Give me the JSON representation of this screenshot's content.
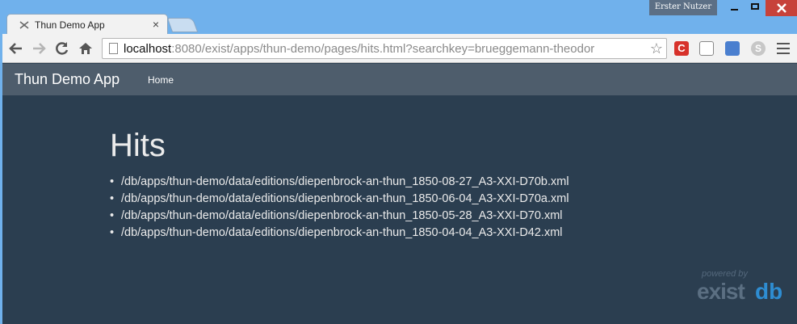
{
  "browser": {
    "tab_title": "Thun Demo App",
    "tab_close": "×",
    "profile_name": "Erster Nutzer",
    "url_host": "localhost",
    "url_rest": ":8080/exist/apps/thun-demo/pages/hits.html?searchkey=brueggemann-theodor",
    "star": "☆",
    "ext_c_label": "C",
    "ext_skype_label": "S"
  },
  "navbar": {
    "brand": "Thun Demo App",
    "home": "Home"
  },
  "main": {
    "heading": "Hits",
    "hits": [
      "/db/apps/thun-demo/data/editions/diepenbrock-an-thun_1850-08-27_A3-XXI-D70b.xml",
      "/db/apps/thun-demo/data/editions/diepenbrock-an-thun_1850-06-04_A3-XXI-D70a.xml",
      "/db/apps/thun-demo/data/editions/diepenbrock-an-thun_1850-05-28_A3-XXI-D70.xml",
      "/db/apps/thun-demo/data/editions/diepenbrock-an-thun_1850-04-04_A3-XXI-D42.xml"
    ]
  },
  "footer_logo": {
    "powered_by": "powered by",
    "exist": "exist",
    "db": "db"
  },
  "colors": {
    "frame": "#70b1ec",
    "navbar": "#4e5d6c",
    "background": "#2b3e50",
    "close_button": "#c7423a"
  }
}
